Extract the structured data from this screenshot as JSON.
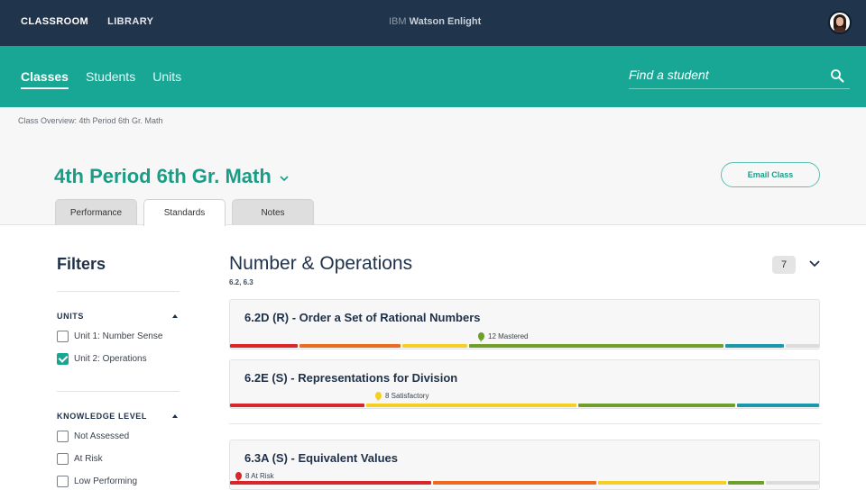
{
  "topbar": {
    "nav": [
      {
        "label": "CLASSROOM",
        "active": true
      },
      {
        "label": "LIBRARY",
        "active": false
      }
    ],
    "brand_prefix": "IBM",
    "brand_name": "Watson Enlight",
    "avatar": "user-avatar"
  },
  "subbar": {
    "tabs": [
      {
        "label": "Classes",
        "active": true
      },
      {
        "label": "Students",
        "active": false
      },
      {
        "label": "Units",
        "active": false
      }
    ],
    "search": {
      "placeholder": "Find a student",
      "value": "",
      "icon": "search-icon"
    }
  },
  "header": {
    "breadcrumb": "Class Overview: 4th Period 6th Gr. Math",
    "title": "4th Period 6th Gr. Math",
    "email_button": "Email Class",
    "tabs": [
      {
        "label": "Performance",
        "active": false
      },
      {
        "label": "Standards",
        "active": true
      },
      {
        "label": "Notes",
        "active": false
      }
    ]
  },
  "filters": {
    "title": "Filters",
    "sections": [
      {
        "label": "UNITS",
        "expanded": true,
        "options": [
          {
            "label": "Unit 1: Number Sense",
            "checked": false
          },
          {
            "label": "Unit 2: Operations",
            "checked": true
          }
        ]
      },
      {
        "label": "KNOWLEDGE LEVEL",
        "expanded": true,
        "options": [
          {
            "label": "Not Assessed",
            "checked": false
          },
          {
            "label": "At Risk",
            "checked": false
          },
          {
            "label": "Low Performing",
            "checked": false
          }
        ]
      }
    ]
  },
  "main": {
    "section_title": "Number & Operations",
    "section_sub": "6.2, 6.3",
    "count": "7",
    "level_colors": {
      "at_risk": "#d9262b",
      "low": "#ee6a1f",
      "satisfactory": "#f5cf24",
      "mastered": "#6f9f2a",
      "advanced": "#1b98ad",
      "not_assessed": "#dcdcdc"
    },
    "standards": [
      {
        "title": "6.2D (R) - Order a Set of Rational Numbers",
        "marker_label": "12 Mastered",
        "marker_level": "mastered",
        "distribution": [
          {
            "level": "at_risk",
            "share": 0.118
          },
          {
            "level": "low",
            "share": 0.175
          },
          {
            "level": "satisfactory",
            "share": 0.113
          },
          {
            "level": "mastered",
            "share": 0.434
          },
          {
            "level": "advanced",
            "share": 0.104
          },
          {
            "level": "not_assessed",
            "share": 0.056
          }
        ]
      },
      {
        "title": "6.2E (S) - Representations for Division",
        "marker_label": "8 Satisfactory",
        "marker_level": "satisfactory",
        "distribution": [
          {
            "level": "at_risk",
            "share": 0.231
          },
          {
            "level": "satisfactory",
            "share": 0.36
          },
          {
            "level": "mastered",
            "share": 0.269
          },
          {
            "level": "advanced",
            "share": 0.14
          }
        ]
      },
      {
        "title": "6.3A (S) - Equivalent Values",
        "marker_label": "8 At Risk",
        "marker_level": "at_risk",
        "distribution": [
          {
            "level": "at_risk",
            "share": 0.345
          },
          {
            "level": "low",
            "share": 0.28
          },
          {
            "level": "satisfactory",
            "share": 0.22
          },
          {
            "level": "mastered",
            "share": 0.065
          },
          {
            "level": "not_assessed",
            "share": 0.09
          }
        ]
      }
    ]
  }
}
